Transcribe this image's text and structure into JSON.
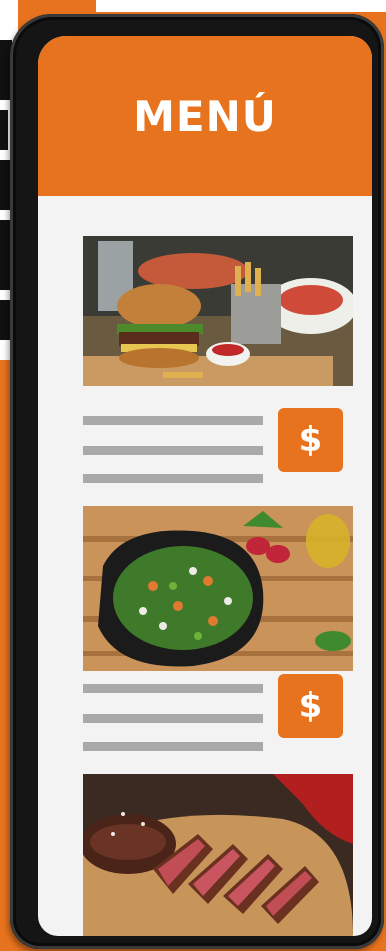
{
  "header": {
    "title": "MENÚ"
  },
  "menu_items": [
    {
      "price_label": "$"
    },
    {
      "price_label": "$"
    }
  ],
  "colors": {
    "accent": "#e8731f",
    "screen_bg": "#f3f3f3",
    "placeholder_line": "#a9a9a9"
  },
  "icons": {
    "price": "dollar-sign"
  }
}
